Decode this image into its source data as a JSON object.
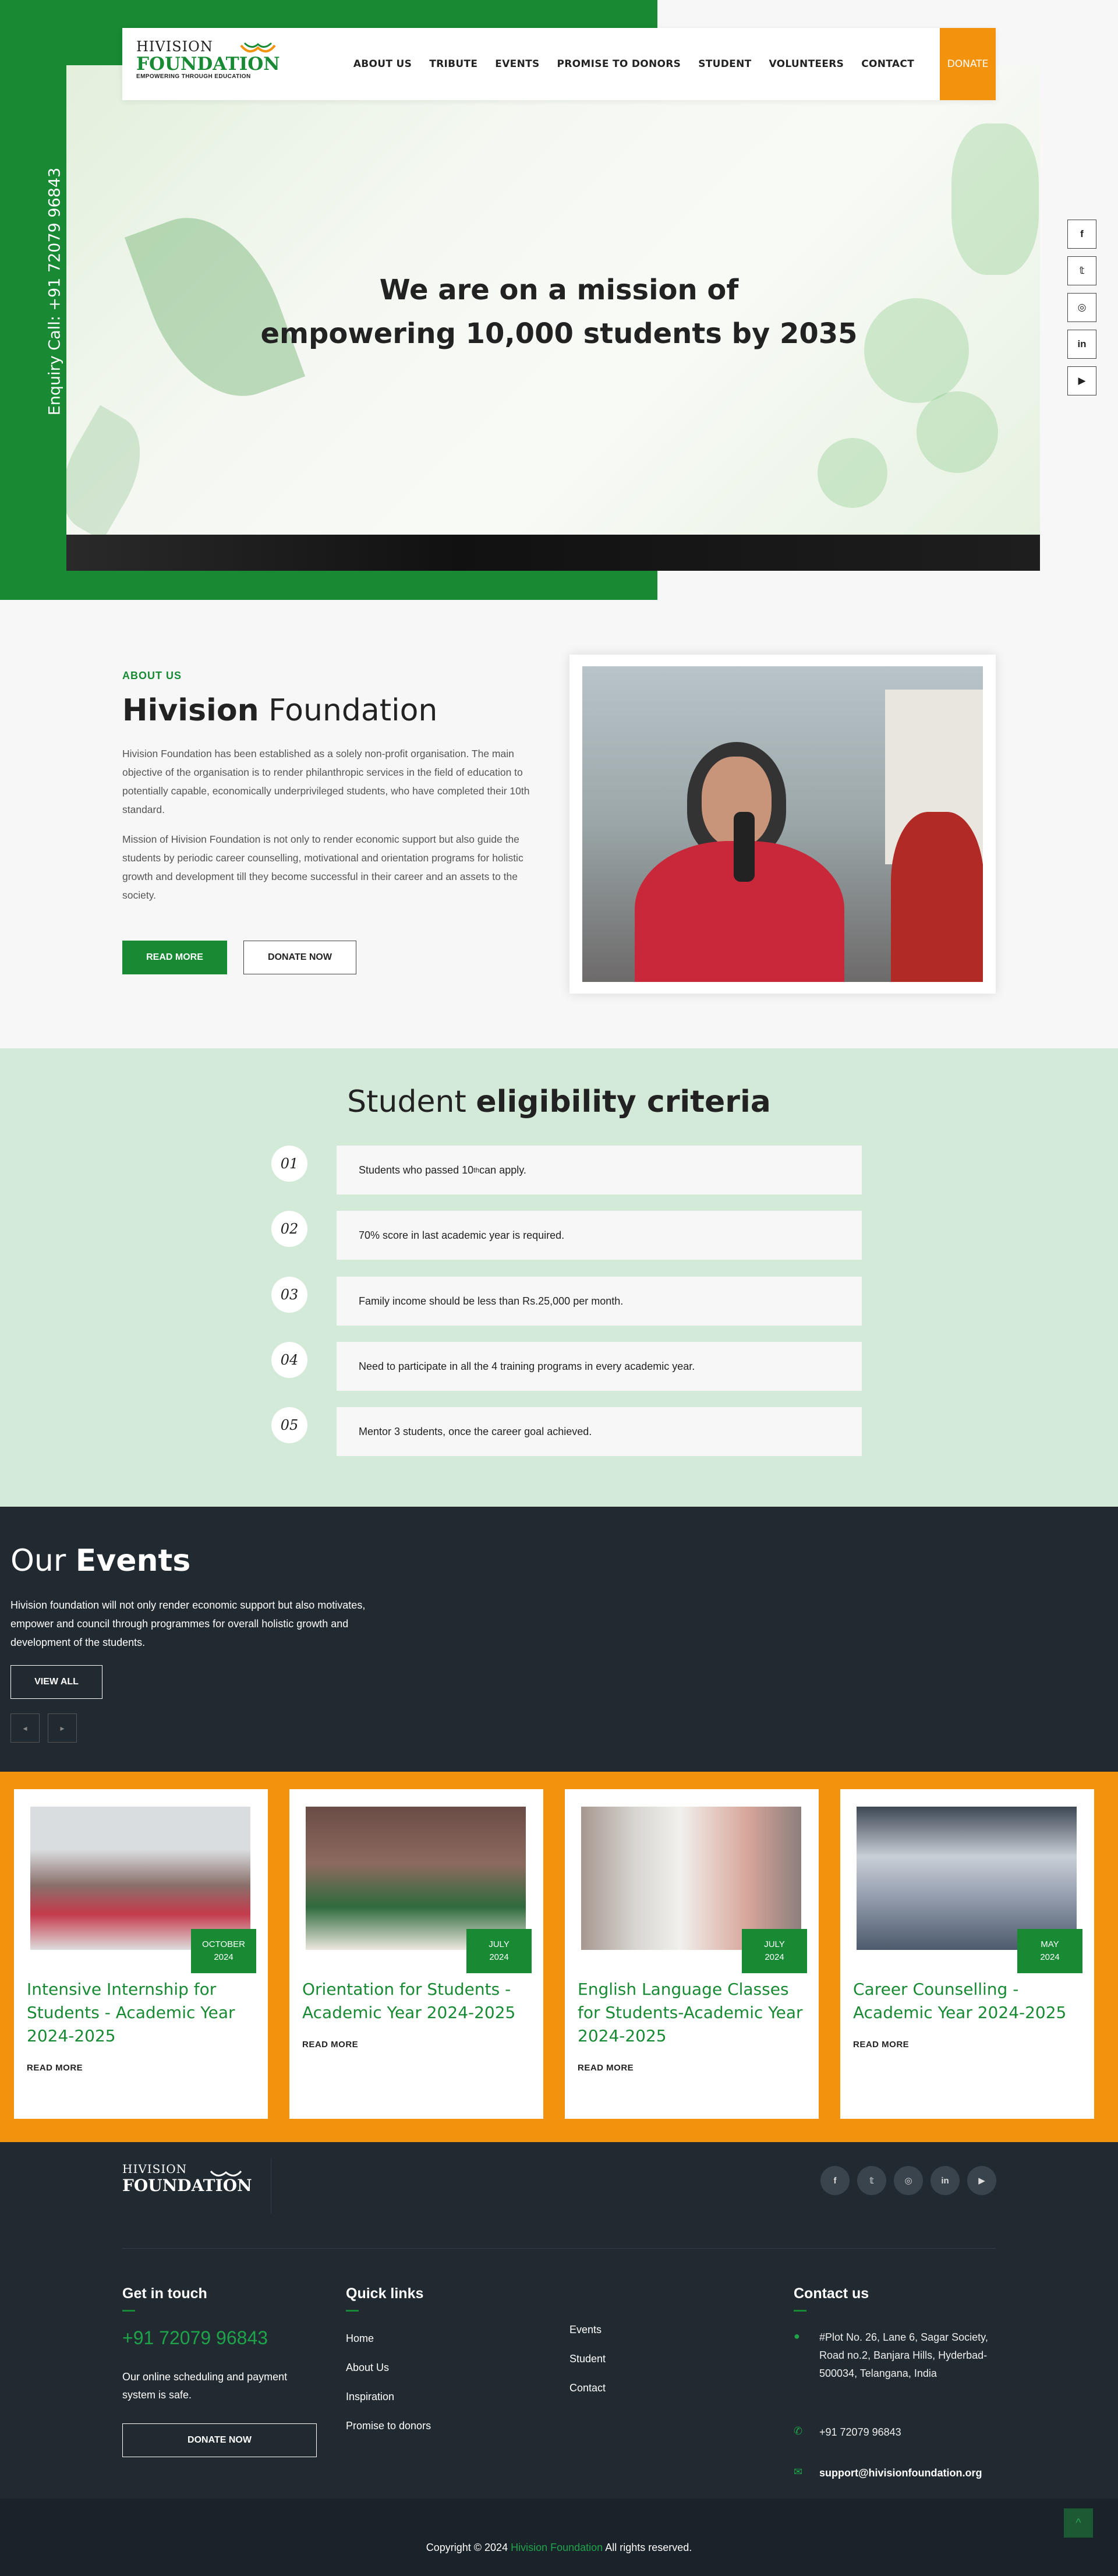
{
  "header": {
    "logo_top": "HIVISION",
    "logo_main": "FOUNDATION",
    "logo_tagline": "EMPOWERING THROUGH EDUCATION",
    "nav": [
      "ABOUT US",
      "TRIBUTE",
      "EVENTS",
      "PROMISE TO DONORS",
      "STUDENT",
      "VOLUNTEERS",
      "CONTACT"
    ],
    "donate": "DONATE"
  },
  "hero": {
    "line1": "We are on a mission of",
    "line2": "empowering 10,000 students by 2035",
    "enquiry": "Enquiry Call: +91 72079 96843",
    "social_icons": [
      "facebook-icon",
      "twitter-icon",
      "instagram-icon",
      "linkedin-icon",
      "youtube-icon"
    ],
    "social_glyphs": [
      "f",
      "𝕥",
      "◎",
      "in",
      "▶"
    ]
  },
  "about": {
    "kicker": "ABOUT US",
    "title_bold": "Hivision",
    "title_rest": " Foundation",
    "p1": "Hivision Foundation has been established as a solely non-profit organisation. The main objective of the organisation is to render philanthropic services in the field of education to potentially capable, economically underprivileged students, who have completed their 10th standard.",
    "p2": "Mission of Hivision Foundation is not only to render economic support but also guide the students by periodic career counselling, motivational and orientation programs for holistic growth and development till they become successful in their career and an assets to the society.",
    "read_more": "READ MORE",
    "donate_now": "DONATE NOW"
  },
  "eligibility": {
    "title_light": "Student ",
    "title_bold": "eligibility criteria",
    "items": [
      {
        "num": "01",
        "pre": "Students who passed 10",
        "sup": "th",
        "post": " can apply."
      },
      {
        "num": "02",
        "pre": "70% score in last academic year is required.",
        "sup": "",
        "post": ""
      },
      {
        "num": "03",
        "pre": "Family income should be less than Rs.25,000 per month.",
        "sup": "",
        "post": ""
      },
      {
        "num": "04",
        "pre": "Need to participate in all the 4 training programs in every academic year.",
        "sup": "",
        "post": ""
      },
      {
        "num": "05",
        "pre": "Mentor 3 students, once the career goal achieved.",
        "sup": "",
        "post": ""
      }
    ]
  },
  "events": {
    "title_light": "Our ",
    "title_bold": "Events",
    "desc": "Hivision foundation will not only render economic support but also motivates, empower and council through programmes for overall holistic growth and development of the students.",
    "view_all": "VIEW ALL",
    "prev": "◂",
    "next": "▸",
    "cards": [
      {
        "month": "OCTOBER",
        "year": "2024",
        "title": "Intensive Internship for Students - Academic Year 2024-2025",
        "read": "READ MORE"
      },
      {
        "month": "JULY",
        "year": "2024",
        "title": "Orientation for Students - Academic Year 2024-2025",
        "read": "READ MORE"
      },
      {
        "month": "JULY",
        "year": "2024",
        "title": "English Language Classes for Students-Academic Year 2024-2025",
        "read": "READ MORE"
      },
      {
        "month": "MAY",
        "year": "2024",
        "title": "Career Counselling - Academic Year 2024-2025",
        "read": "READ MORE"
      }
    ]
  },
  "footer": {
    "logo_top": "HIVISION",
    "logo_main": "FOUNDATION",
    "social_glyphs": [
      "f",
      "𝕥",
      "◎",
      "in",
      "▶"
    ],
    "get_in_touch": "Get in touch",
    "phone_big": "+91 72079 96843",
    "schedule_text": "Our online scheduling and payment system is safe.",
    "donate_now": "DONATE NOW",
    "quick_links": "Quick links",
    "links_col1": [
      "Home",
      "About Us",
      "Inspiration",
      "Promise to donors"
    ],
    "links_col2": [
      "Events",
      "Student",
      "Contact"
    ],
    "contact_us": "Contact us",
    "address": "#Plot No. 26, Lane 6, Sagar Society, Road no.2, Banjara Hills, Hyderbad-500034, Telangana, India",
    "phone": "+91 72079 96843",
    "email": "support@hivisionfoundation.org",
    "copy_pre": "Copyright © 2024 ",
    "copy_brand": "Hivision Foundation",
    "copy_post": " All rights reserved.",
    "scroll_top": "^"
  },
  "colors": {
    "green": "#178a33",
    "orange": "#f3920c",
    "dark": "#212a31"
  }
}
